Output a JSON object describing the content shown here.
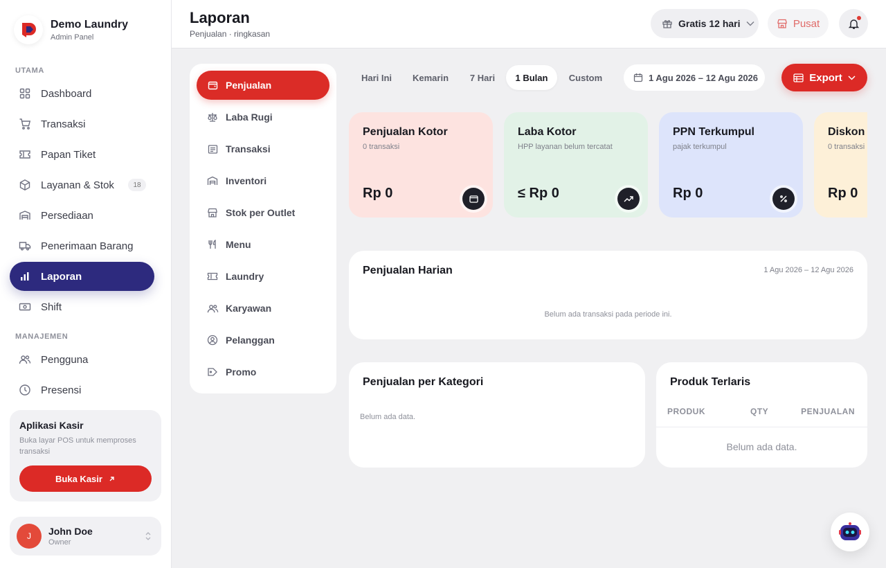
{
  "brand": {
    "name": "Demo Laundry",
    "subtitle": "Admin Panel"
  },
  "sidebar": {
    "sections": [
      {
        "label": "UTAMA"
      },
      {
        "label": "MANAJEMEN"
      }
    ],
    "items": [
      {
        "label": "Dashboard",
        "icon": "grid-icon"
      },
      {
        "label": "Transaksi",
        "icon": "cart-icon"
      },
      {
        "label": "Papan Tiket",
        "icon": "ticket-icon"
      },
      {
        "label": "Layanan & Stok",
        "icon": "box-icon",
        "badge": "18"
      },
      {
        "label": "Persediaan",
        "icon": "warehouse-icon"
      },
      {
        "label": "Penerimaan Barang",
        "icon": "truck-icon"
      },
      {
        "label": "Laporan",
        "icon": "bar-chart-icon",
        "active": true
      },
      {
        "label": "Shift",
        "icon": "cash-icon"
      },
      {
        "label": "Pengguna",
        "icon": "users-icon"
      },
      {
        "label": "Presensi",
        "icon": "clock-icon"
      }
    ],
    "cashier": {
      "title": "Aplikasi Kasir",
      "desc": "Buka layar POS untuk memproses transaksi",
      "button": "Buka Kasir"
    },
    "user": {
      "name": "John Doe",
      "role": "Owner",
      "initial": "J"
    }
  },
  "header": {
    "title": "Laporan",
    "subtitle": "Penjualan · ringkasan",
    "trial": "Gratis 12 hari",
    "outlet": "Pusat"
  },
  "report_menu": [
    {
      "label": "Penjualan",
      "icon": "wallet-icon",
      "active": true
    },
    {
      "label": "Laba Rugi",
      "icon": "scale-icon"
    },
    {
      "label": "Transaksi",
      "icon": "receipt-icon"
    },
    {
      "label": "Inventori",
      "icon": "warehouse-icon"
    },
    {
      "label": "Stok per Outlet",
      "icon": "store-icon"
    },
    {
      "label": "Menu",
      "icon": "utensils-icon"
    },
    {
      "label": "Laundry",
      "icon": "ticket-icon"
    },
    {
      "label": "Karyawan",
      "icon": "users-icon"
    },
    {
      "label": "Pelanggan",
      "icon": "user-circle-icon"
    },
    {
      "label": "Promo",
      "icon": "tag-icon"
    }
  ],
  "filters": {
    "periods": [
      "Hari Ini",
      "Kemarin",
      "7 Hari",
      "1 Bulan",
      "Custom"
    ],
    "active_period": "1 Bulan",
    "date_range": "1 Agu 2026 – 12 Agu 2026",
    "export": "Export"
  },
  "kpis": [
    {
      "title": "Penjualan Kotor",
      "sub": "0 transaksi",
      "value": "Rp 0",
      "bg": "#fde3e0",
      "icon": "wallet-icon"
    },
    {
      "title": "Laba Kotor",
      "sub": "HPP layanan belum tercatat",
      "value": "≤ Rp 0",
      "bg": "#e2f2e7",
      "icon": "trend-up-icon"
    },
    {
      "title": "PPN Terkumpul",
      "sub": "pajak terkumpul",
      "value": "Rp 0",
      "bg": "#dde4fb",
      "icon": "percent-icon"
    },
    {
      "title": "Diskon D",
      "sub": "0 transaksi",
      "value": "Rp 0",
      "bg": "#fdf0d8",
      "icon": "tag-icon"
    }
  ],
  "daily": {
    "title": "Penjualan Harian",
    "range": "1 Agu 2026 – 12 Agu 2026",
    "empty": "Belum ada transaksi pada periode ini."
  },
  "category": {
    "title": "Penjualan per Kategori",
    "empty": "Belum ada data."
  },
  "top_products": {
    "title": "Produk Terlaris",
    "columns": [
      "PRODUK",
      "QTY",
      "PENJUALAN"
    ],
    "empty": "Belum ada data."
  },
  "colors": {
    "brand_red": "#dc2a26",
    "active_nav": "#2d2a7e"
  }
}
